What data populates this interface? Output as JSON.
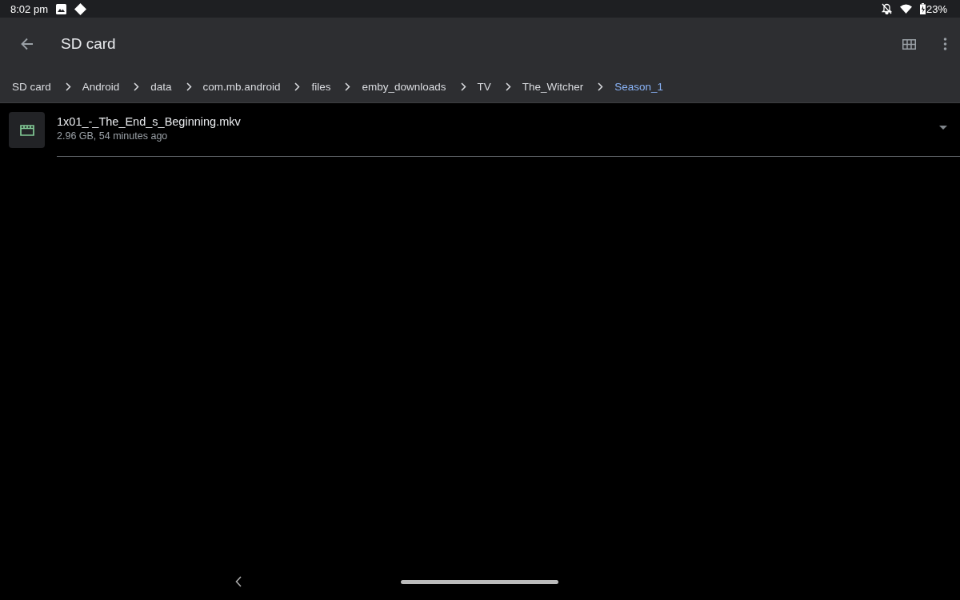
{
  "status_bar": {
    "time": "8:02 pm",
    "battery": "23%"
  },
  "toolbar": {
    "title": "SD card"
  },
  "breadcrumbs": [
    {
      "label": "SD card",
      "selected": false
    },
    {
      "label": "Android",
      "selected": false
    },
    {
      "label": "data",
      "selected": false
    },
    {
      "label": "com.mb.android",
      "selected": false
    },
    {
      "label": "files",
      "selected": false
    },
    {
      "label": "emby_downloads",
      "selected": false
    },
    {
      "label": "TV",
      "selected": false
    },
    {
      "label": "The_Witcher",
      "selected": false
    },
    {
      "label": "Season_1",
      "selected": true
    }
  ],
  "files": [
    {
      "name": "1x01_-_The_End_s_Beginning.mkv",
      "details": "2.96 GB, 54 minutes ago",
      "kind": "video"
    }
  ]
}
